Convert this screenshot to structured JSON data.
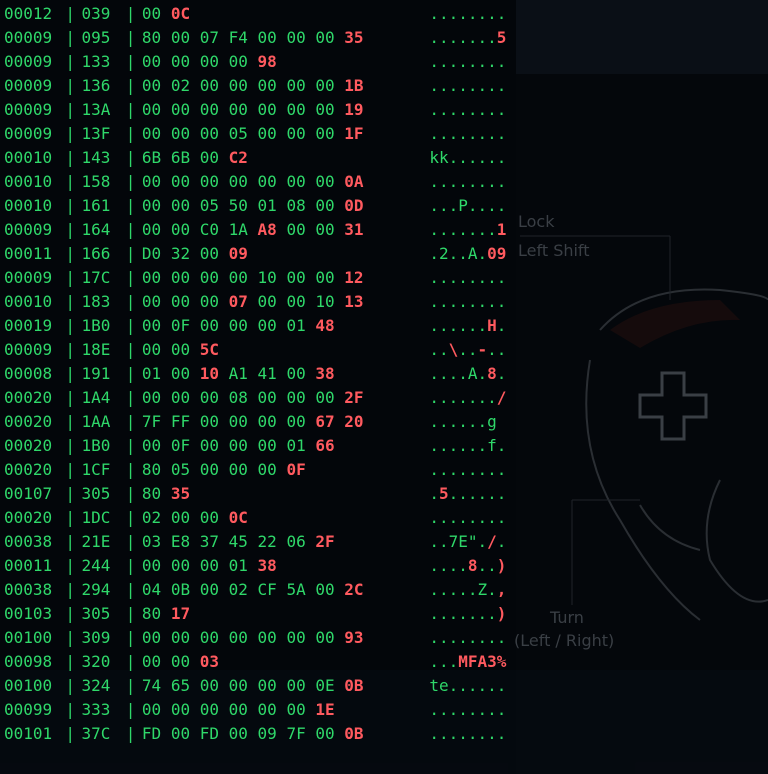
{
  "rows": [
    {
      "pid": "00012",
      "can": "039",
      "bytes": [
        [
          "00",
          0
        ],
        [
          "0C",
          1
        ]
      ],
      "ascii": [
        [
          "........",
          0
        ]
      ]
    },
    {
      "pid": "00009",
      "can": "095",
      "bytes": [
        [
          "80",
          0
        ],
        [
          "00",
          0
        ],
        [
          "07",
          0
        ],
        [
          "F4",
          0
        ],
        [
          "00",
          0
        ],
        [
          "00",
          0
        ],
        [
          "00",
          0
        ],
        [
          "35",
          1
        ]
      ],
      "ascii": [
        [
          ".......",
          0
        ],
        [
          "5",
          1
        ]
      ]
    },
    {
      "pid": "00009",
      "can": "133",
      "bytes": [
        [
          "00",
          0
        ],
        [
          "00",
          0
        ],
        [
          "00",
          0
        ],
        [
          "00",
          0
        ],
        [
          "98",
          1
        ]
      ],
      "ascii": [
        [
          "........",
          0
        ]
      ]
    },
    {
      "pid": "00009",
      "can": "136",
      "bytes": [
        [
          "00",
          0
        ],
        [
          "02",
          0
        ],
        [
          "00",
          0
        ],
        [
          "00",
          0
        ],
        [
          "00",
          0
        ],
        [
          "00",
          0
        ],
        [
          "00",
          0
        ],
        [
          "1B",
          1
        ]
      ],
      "ascii": [
        [
          "........",
          0
        ]
      ]
    },
    {
      "pid": "00009",
      "can": "13A",
      "bytes": [
        [
          "00",
          0
        ],
        [
          "00",
          0
        ],
        [
          "00",
          0
        ],
        [
          "00",
          0
        ],
        [
          "00",
          0
        ],
        [
          "00",
          0
        ],
        [
          "00",
          0
        ],
        [
          "19",
          1
        ]
      ],
      "ascii": [
        [
          "........",
          0
        ]
      ]
    },
    {
      "pid": "00009",
      "can": "13F",
      "bytes": [
        [
          "00",
          0
        ],
        [
          "00",
          0
        ],
        [
          "00",
          0
        ],
        [
          "05",
          0
        ],
        [
          "00",
          0
        ],
        [
          "00",
          0
        ],
        [
          "00",
          0
        ],
        [
          "1F",
          1
        ]
      ],
      "ascii": [
        [
          "........",
          0
        ]
      ]
    },
    {
      "pid": "00010",
      "can": "143",
      "bytes": [
        [
          "6B",
          0
        ],
        [
          "6B",
          0
        ],
        [
          "00",
          0
        ],
        [
          "C2",
          1
        ]
      ],
      "ascii": [
        [
          "kk......",
          0
        ]
      ]
    },
    {
      "pid": "00010",
      "can": "158",
      "bytes": [
        [
          "00",
          0
        ],
        [
          "00",
          0
        ],
        [
          "00",
          0
        ],
        [
          "00",
          0
        ],
        [
          "00",
          0
        ],
        [
          "00",
          0
        ],
        [
          "00",
          0
        ],
        [
          "0A",
          1
        ]
      ],
      "ascii": [
        [
          "........",
          0
        ]
      ]
    },
    {
      "pid": "00010",
      "can": "161",
      "bytes": [
        [
          "00",
          0
        ],
        [
          "00",
          0
        ],
        [
          "05",
          0
        ],
        [
          "50",
          0
        ],
        [
          "01",
          0
        ],
        [
          "08",
          0
        ],
        [
          "00",
          0
        ],
        [
          "0D",
          1
        ]
      ],
      "ascii": [
        [
          "...P....",
          0
        ]
      ]
    },
    {
      "pid": "00009",
      "can": "164",
      "bytes": [
        [
          "00",
          0
        ],
        [
          "00",
          0
        ],
        [
          "C0",
          0
        ],
        [
          "1A",
          0
        ],
        [
          "A8",
          1
        ],
        [
          "00",
          0
        ],
        [
          "00",
          0
        ],
        [
          "31",
          1
        ]
      ],
      "ascii": [
        [
          ".......",
          0
        ],
        [
          "1",
          1
        ]
      ]
    },
    {
      "pid": "00011",
      "can": "166",
      "bytes": [
        [
          "D0",
          0
        ],
        [
          "32",
          0
        ],
        [
          "00",
          0
        ],
        [
          "09",
          1
        ]
      ],
      "ascii": [
        [
          ".2..A.",
          0
        ],
        [
          "09",
          1
        ]
      ]
    },
    {
      "pid": "00009",
      "can": "17C",
      "bytes": [
        [
          "00",
          0
        ],
        [
          "00",
          0
        ],
        [
          "00",
          0
        ],
        [
          "00",
          0
        ],
        [
          "10",
          0
        ],
        [
          "00",
          0
        ],
        [
          "00",
          0
        ],
        [
          "12",
          1
        ]
      ],
      "ascii": [
        [
          "........",
          0
        ]
      ]
    },
    {
      "pid": "00010",
      "can": "183",
      "bytes": [
        [
          "00",
          0
        ],
        [
          "00",
          0
        ],
        [
          "00",
          0
        ],
        [
          "07",
          1
        ],
        [
          "00",
          0
        ],
        [
          "00",
          0
        ],
        [
          "10",
          0
        ],
        [
          "13",
          1
        ]
      ],
      "ascii": [
        [
          "........",
          0
        ]
      ]
    },
    {
      "pid": "00019",
      "can": "1B0",
      "bytes": [
        [
          "00",
          0
        ],
        [
          "0F",
          0
        ],
        [
          "00",
          0
        ],
        [
          "00",
          0
        ],
        [
          "00",
          0
        ],
        [
          "01",
          0
        ],
        [
          "48",
          1
        ]
      ],
      "ascii": [
        [
          "......",
          0
        ],
        [
          "H",
          1
        ],
        [
          ".",
          0
        ]
      ]
    },
    {
      "pid": "00009",
      "can": "18E",
      "bytes": [
        [
          "00",
          0
        ],
        [
          "00",
          0
        ],
        [
          "5C",
          1
        ]
      ],
      "ascii": [
        [
          "..",
          0
        ],
        [
          "\\",
          1
        ],
        [
          "..",
          0
        ],
        [
          "-",
          1
        ],
        [
          "..",
          0
        ]
      ]
    },
    {
      "pid": "00008",
      "can": "191",
      "bytes": [
        [
          "01",
          0
        ],
        [
          "00",
          0
        ],
        [
          "10",
          1
        ],
        [
          "A1",
          0
        ],
        [
          "41",
          0
        ],
        [
          "00",
          0
        ],
        [
          "38",
          1
        ]
      ],
      "ascii": [
        [
          "....A.",
          0
        ],
        [
          "8",
          1
        ],
        [
          ".",
          0
        ]
      ]
    },
    {
      "pid": "00020",
      "can": "1A4",
      "bytes": [
        [
          "00",
          0
        ],
        [
          "00",
          0
        ],
        [
          "00",
          0
        ],
        [
          "08",
          0
        ],
        [
          "00",
          0
        ],
        [
          "00",
          0
        ],
        [
          "00",
          0
        ],
        [
          "2F",
          1
        ]
      ],
      "ascii": [
        [
          ".......",
          0
        ],
        [
          "/",
          1
        ]
      ]
    },
    {
      "pid": "00020",
      "can": "1AA",
      "bytes": [
        [
          "7F",
          0
        ],
        [
          "FF",
          0
        ],
        [
          "00",
          0
        ],
        [
          "00",
          0
        ],
        [
          "00",
          0
        ],
        [
          "00",
          0
        ],
        [
          "67",
          1
        ],
        [
          "20",
          1
        ]
      ],
      "ascii": [
        [
          "......g",
          0
        ]
      ]
    },
    {
      "pid": "00020",
      "can": "1B0",
      "bytes": [
        [
          "00",
          0
        ],
        [
          "0F",
          0
        ],
        [
          "00",
          0
        ],
        [
          "00",
          0
        ],
        [
          "00",
          0
        ],
        [
          "01",
          0
        ],
        [
          "66",
          1
        ]
      ],
      "ascii": [
        [
          "......f.",
          0
        ]
      ]
    },
    {
      "pid": "00020",
      "can": "1CF",
      "bytes": [
        [
          "80",
          0
        ],
        [
          "05",
          0
        ],
        [
          "00",
          0
        ],
        [
          "00",
          0
        ],
        [
          "00",
          0
        ],
        [
          "0F",
          1
        ]
      ],
      "ascii": [
        [
          "........",
          0
        ]
      ]
    },
    {
      "pid": "00107",
      "can": "305",
      "bytes": [
        [
          "80",
          0
        ],
        [
          "35",
          1
        ]
      ],
      "ascii": [
        [
          ".",
          0
        ],
        [
          "5",
          1
        ],
        [
          "......",
          0
        ]
      ]
    },
    {
      "pid": "00020",
      "can": "1DC",
      "bytes": [
        [
          "02",
          0
        ],
        [
          "00",
          0
        ],
        [
          "00",
          0
        ],
        [
          "0C",
          1
        ]
      ],
      "ascii": [
        [
          "........",
          0
        ]
      ]
    },
    {
      "pid": "00038",
      "can": "21E",
      "bytes": [
        [
          "03",
          0
        ],
        [
          "E8",
          0
        ],
        [
          "37",
          0
        ],
        [
          "45",
          0
        ],
        [
          "22",
          0
        ],
        [
          "06",
          0
        ],
        [
          "2F",
          1
        ]
      ],
      "ascii": [
        [
          "..7E\".",
          0
        ],
        [
          "/",
          1
        ],
        [
          ".",
          0
        ]
      ]
    },
    {
      "pid": "00011",
      "can": "244",
      "bytes": [
        [
          "00",
          0
        ],
        [
          "00",
          0
        ],
        [
          "00",
          0
        ],
        [
          "01",
          0
        ],
        [
          "38",
          1
        ]
      ],
      "ascii": [
        [
          "....",
          0
        ],
        [
          "8",
          1
        ],
        [
          "..",
          0
        ],
        [
          ")",
          1
        ]
      ]
    },
    {
      "pid": "00038",
      "can": "294",
      "bytes": [
        [
          "04",
          0
        ],
        [
          "0B",
          0
        ],
        [
          "00",
          0
        ],
        [
          "02",
          0
        ],
        [
          "CF",
          0
        ],
        [
          "5A",
          0
        ],
        [
          "00",
          0
        ],
        [
          "2C",
          1
        ]
      ],
      "ascii": [
        [
          ".....Z.",
          0
        ],
        [
          ",",
          1
        ]
      ]
    },
    {
      "pid": "00103",
      "can": "305",
      "bytes": [
        [
          "80",
          0
        ],
        [
          "17",
          1
        ]
      ],
      "ascii": [
        [
          ".......",
          0
        ],
        [
          ")",
          1
        ]
      ]
    },
    {
      "pid": "00100",
      "can": "309",
      "bytes": [
        [
          "00",
          0
        ],
        [
          "00",
          0
        ],
        [
          "00",
          0
        ],
        [
          "00",
          0
        ],
        [
          "00",
          0
        ],
        [
          "00",
          0
        ],
        [
          "00",
          0
        ],
        [
          "93",
          1
        ]
      ],
      "ascii": [
        [
          "........",
          0
        ]
      ]
    },
    {
      "pid": "00098",
      "can": "320",
      "bytes": [
        [
          "00",
          0
        ],
        [
          "00",
          0
        ],
        [
          "03",
          1
        ]
      ],
      "ascii": [
        [
          "...",
          0
        ],
        [
          "MFA3%",
          1
        ]
      ]
    },
    {
      "pid": "00100",
      "can": "324",
      "bytes": [
        [
          "74",
          0
        ],
        [
          "65",
          0
        ],
        [
          "00",
          0
        ],
        [
          "00",
          0
        ],
        [
          "00",
          0
        ],
        [
          "00",
          0
        ],
        [
          "0E",
          0
        ],
        [
          "0B",
          1
        ]
      ],
      "ascii": [
        [
          "te......",
          0
        ]
      ]
    },
    {
      "pid": "00099",
      "can": "333",
      "bytes": [
        [
          "00",
          0
        ],
        [
          "00",
          0
        ],
        [
          "00",
          0
        ],
        [
          "00",
          0
        ],
        [
          "00",
          0
        ],
        [
          "00",
          0
        ],
        [
          "1E",
          1
        ]
      ],
      "ascii": [
        [
          "........",
          0
        ]
      ]
    },
    {
      "pid": "00101",
      "can": "37C",
      "bytes": [
        [
          "FD",
          0
        ],
        [
          "00",
          0
        ],
        [
          "FD",
          0
        ],
        [
          "00",
          0
        ],
        [
          "09",
          0
        ],
        [
          "7F",
          0
        ],
        [
          "00",
          0
        ],
        [
          "0B",
          1
        ]
      ],
      "ascii": [
        [
          "........",
          0
        ]
      ]
    }
  ],
  "background_labels": {
    "lock": "Lock",
    "left_shift": "Left Shift",
    "turn": "Turn",
    "turn_sub": "(Left / Right)"
  },
  "colors": {
    "text": "#2fd86a",
    "highlight": "#ff5a5f",
    "background": "#03060a"
  }
}
